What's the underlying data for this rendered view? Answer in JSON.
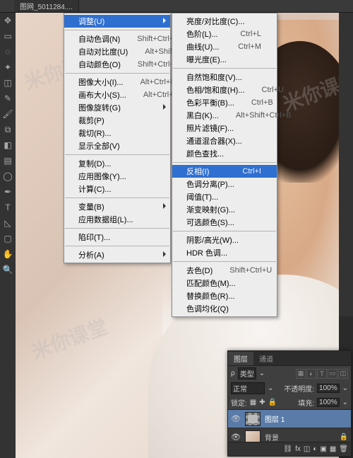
{
  "tab_title": "图网_5011284....",
  "watermark_text": "米你课堂",
  "menu1": {
    "highlighted": {
      "label": "调整(U)"
    },
    "groups": [
      [
        {
          "label": "自动色调(N)",
          "shortcut": "Shift+Ctrl+L"
        },
        {
          "label": "自动对比度(U)",
          "shortcut": "Alt+Shift+Ctrl+L"
        },
        {
          "label": "自动颜色(O)",
          "shortcut": "Shift+Ctrl+B"
        }
      ],
      [
        {
          "label": "图像大小(I)...",
          "shortcut": "Alt+Ctrl+I"
        },
        {
          "label": "画布大小(S)...",
          "shortcut": "Alt+Ctrl+C"
        },
        {
          "label": "图像旋转(G)",
          "sub": true
        },
        {
          "label": "裁剪(P)"
        },
        {
          "label": "裁切(R)..."
        },
        {
          "label": "显示全部(V)"
        }
      ],
      [
        {
          "label": "复制(D)..."
        },
        {
          "label": "应用图像(Y)..."
        },
        {
          "label": "计算(C)..."
        }
      ],
      [
        {
          "label": "变量(B)",
          "sub": true
        },
        {
          "label": "应用数据组(L)..."
        }
      ],
      [
        {
          "label": "陷印(T)..."
        }
      ],
      [
        {
          "label": "分析(A)",
          "sub": true
        }
      ]
    ]
  },
  "menu2": {
    "groups": [
      [
        {
          "label": "亮度/对比度(C)..."
        },
        {
          "label": "色阶(L)...",
          "shortcut": "Ctrl+L"
        },
        {
          "label": "曲线(U)...",
          "shortcut": "Ctrl+M"
        },
        {
          "label": "曝光度(E)..."
        }
      ],
      [
        {
          "label": "自然饱和度(V)..."
        },
        {
          "label": "色相/饱和度(H)...",
          "shortcut": "Ctrl+U"
        },
        {
          "label": "色彩平衡(B)...",
          "shortcut": "Ctrl+B"
        },
        {
          "label": "黑白(K)...",
          "shortcut": "Alt+Shift+Ctrl+B"
        },
        {
          "label": "照片滤镜(F)..."
        },
        {
          "label": "通道混合器(X)..."
        },
        {
          "label": "颜色查找..."
        }
      ],
      [
        {
          "label": "反相(I)",
          "shortcut": "Ctrl+I",
          "hl": true
        },
        {
          "label": "色调分离(P)..."
        },
        {
          "label": "阈值(T)..."
        },
        {
          "label": "渐变映射(G)..."
        },
        {
          "label": "可选颜色(S)..."
        }
      ],
      [
        {
          "label": "阴影/高光(W)..."
        },
        {
          "label": "HDR 色调..."
        }
      ],
      [
        {
          "label": "去色(D)",
          "shortcut": "Shift+Ctrl+U"
        },
        {
          "label": "匹配颜色(M)..."
        },
        {
          "label": "替换颜色(R)..."
        },
        {
          "label": "色调均化(Q)"
        }
      ]
    ]
  },
  "layers_panel": {
    "tabs": {
      "layers": "图层",
      "channels": "通道"
    },
    "kind_label": "类型",
    "blend_mode": "正常",
    "opacity_label": "不透明度:",
    "opacity_value": "100%",
    "lock_label": "锁定:",
    "fill_label": "填充:",
    "fill_value": "100%",
    "layers": [
      {
        "name": "图层 1",
        "selected": true
      },
      {
        "name": "背景",
        "locked": true
      }
    ]
  }
}
